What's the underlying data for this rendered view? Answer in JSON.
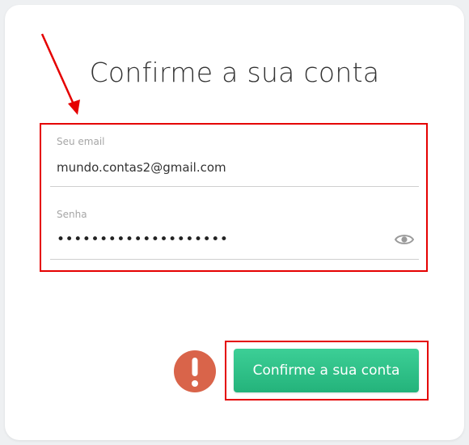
{
  "page": {
    "title": "Confirme a sua conta"
  },
  "form": {
    "email": {
      "label": "Seu email",
      "value": "mundo.contas2@gmail.com"
    },
    "password": {
      "label": "Senha",
      "masked_value": "••••••••••••••••••••",
      "visibility_icon": "eye-icon"
    },
    "submit_label": "Confirme a sua conta",
    "alert_icon": "exclamation-icon"
  },
  "annotations": {
    "highlight_color": "#e50000",
    "arrow_color": "#e50000"
  },
  "colors": {
    "button": "#2cc086",
    "alert": "#d9644a",
    "title_text": "#333333",
    "label_text": "#a6a6a6"
  }
}
